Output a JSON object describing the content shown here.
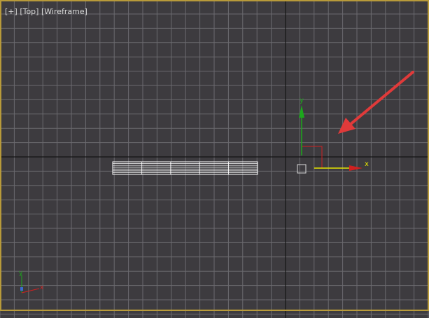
{
  "viewport": {
    "label_parts": [
      "[+]",
      "[Top]",
      "[Wireframe]"
    ],
    "background_color": "#3d3b3f",
    "grid_color": "#6b6a6f",
    "axis_line_color": "#141414",
    "border_color": "#b89a3a"
  },
  "gizmo": {
    "x_label": "x",
    "y_label": "y",
    "x_color": "#d02020",
    "y_color": "#1ca81c",
    "highlight_color": "#e6e600"
  },
  "corner_axis": {
    "x_label": "x",
    "y_label": "y"
  },
  "annotation": {
    "arrow_color": "#e03a3a",
    "icon": "red-pointer-arrow-icon"
  },
  "objects": {
    "selected_object": "white-wireframe-plane",
    "pivot_marker": "pivot-square-icon"
  }
}
